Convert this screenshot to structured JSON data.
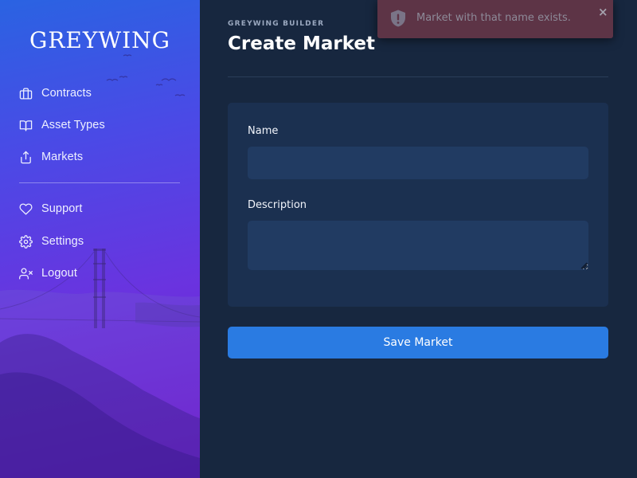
{
  "brand": {
    "logo_text": "GREYWING"
  },
  "sidebar": {
    "items": [
      {
        "label": "Contracts",
        "icon": "briefcase-icon"
      },
      {
        "label": "Asset Types",
        "icon": "book-icon"
      },
      {
        "label": "Markets",
        "icon": "upload-icon"
      },
      {
        "label": "Support",
        "icon": "heart-icon"
      },
      {
        "label": "Settings",
        "icon": "gear-icon"
      },
      {
        "label": "Logout",
        "icon": "user-x-icon"
      }
    ]
  },
  "header": {
    "eyebrow": "GREYWING BUILDER",
    "title": "Create Market"
  },
  "form": {
    "name_label": "Name",
    "name_value": "",
    "description_label": "Description",
    "description_value": "",
    "save_label": "Save Market"
  },
  "toast": {
    "message": "Market with that name exists.",
    "close_symbol": "×",
    "icon": "shield-alert-icon"
  },
  "colors": {
    "background": "#17273f",
    "card": "#1b3050",
    "input": "#213b62",
    "primary_button": "#2a7be2",
    "sidebar_gradient_start": "#2a63e2",
    "sidebar_gradient_end": "#6f12cf",
    "toast": "#5d3446"
  }
}
